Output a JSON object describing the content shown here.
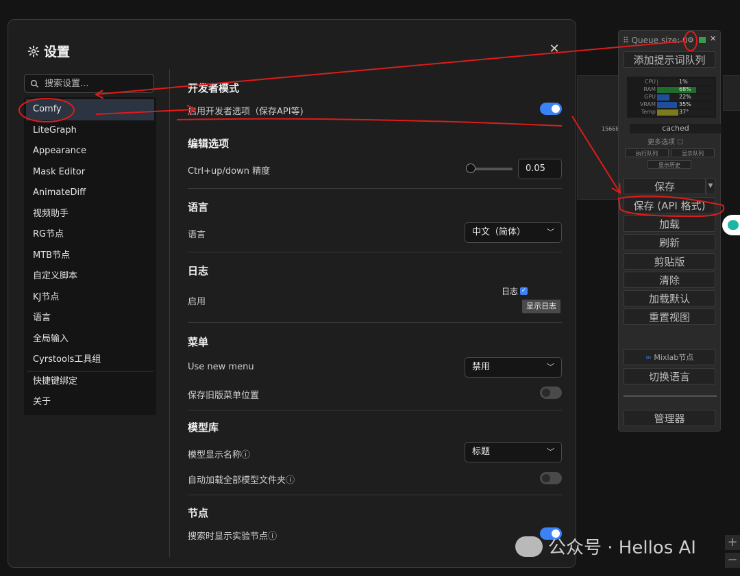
{
  "dialog": {
    "title": "设置",
    "search_placeholder": "搜索设置..."
  },
  "nav": {
    "items": [
      "Comfy",
      "LiteGraph",
      "Appearance",
      "Mask Editor",
      "AnimateDiff",
      "视频助手",
      "RG节点",
      "MTB节点",
      "自定义脚本",
      "KJ节点",
      "语言",
      "全局输入",
      "Cyrstools工具组"
    ],
    "items2": [
      "快捷键绑定",
      "关于"
    ],
    "active_index": 0
  },
  "sections": {
    "dev": {
      "title": "开发者模式",
      "label": "启用开发者选项（保存API等)",
      "toggle_on": true
    },
    "edit": {
      "title": "编辑选项",
      "label": "Ctrl+up/down 精度",
      "value": "0.05"
    },
    "lang": {
      "title": "语言",
      "label": "语言",
      "value": "中文（简体）"
    },
    "log": {
      "title": "日志",
      "label": "启用",
      "checkbox_label": "日志",
      "button": "显示日志"
    },
    "menu": {
      "title": "菜单",
      "label1": "Use new menu",
      "value1": "禁用",
      "label2": "保存旧版菜单位置",
      "toggle2_on": false
    },
    "model": {
      "title": "模型库",
      "label1": "模型显示名称",
      "value1": "标题",
      "label2": "自动加载全部模型文件夹",
      "toggle2_on": false
    },
    "nodes": {
      "title": "节点",
      "label1": "搜索时显示实验节点",
      "toggle1_on": true
    }
  },
  "queue_panel": {
    "header": "Queue size: 0",
    "add_queue": "添加提示词队列",
    "stats": [
      {
        "label": "CPU",
        "value": "1%",
        "pct": 1,
        "color": "#1f6d2a"
      },
      {
        "label": "RAM",
        "value": "68%",
        "pct": 68,
        "color": "#1f6d2a"
      },
      {
        "label": "GPU",
        "value": "22%",
        "pct": 22,
        "color": "#1f4f9a"
      },
      {
        "label": "VRAM",
        "value": "35%",
        "pct": 35,
        "color": "#1f4f9a"
      },
      {
        "label": "Temp",
        "value": "37°",
        "pct": 37,
        "color": "#7a7a1f"
      }
    ],
    "cached": "cached",
    "more_options": "更多选项",
    "exec_queue": "执行队列",
    "show_queue": "显示队列",
    "show_history": "显示历史",
    "buttons": [
      "保存",
      "保存 (API 格式)",
      "加载",
      "刷新",
      "剪贴版",
      "清除",
      "加载默认",
      "重置视图"
    ],
    "mixlab": "Mixlab节点",
    "switch_lang": "切换语言",
    "manager": "管理器"
  },
  "watermark": "公众号 · Hellos AI",
  "bg_number": "15668"
}
